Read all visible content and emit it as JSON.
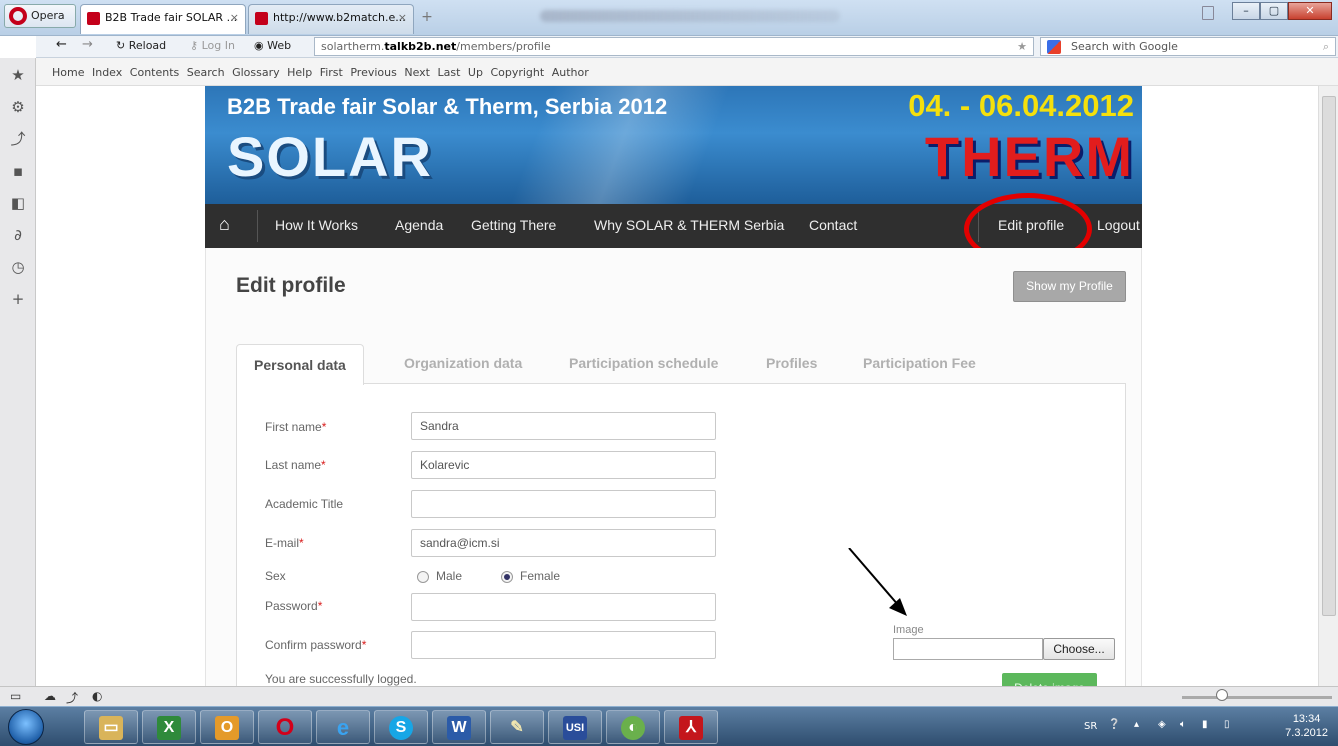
{
  "browser": {
    "opera_label": "Opera",
    "tabs": [
      {
        "title": "B2B Trade fair SOLAR ...",
        "close": "×"
      },
      {
        "title": "http://www.b2match.e...",
        "close": "×"
      }
    ],
    "new_tab": "+",
    "reload_label": "Reload",
    "login_label": "Log In",
    "web_label": "Web",
    "url_prefix": "solartherm.",
    "url_domain": "talkb2b.net",
    "url_path": "/members/profile",
    "search_placeholder": "Search with Google",
    "bookmarks": [
      "Home",
      "Index",
      "Contents",
      "Search",
      "Glossary",
      "Help",
      "First",
      "Previous",
      "Next",
      "Last",
      "Up",
      "Copyright",
      "Author"
    ]
  },
  "header": {
    "title": "B2B Trade fair Solar & Therm, Serbia 2012",
    "dates": "04. - 06.04.2012",
    "logo_left": "SOLAR",
    "logo_right": "THERM"
  },
  "nav": {
    "items": [
      "How It Works",
      "Agenda",
      "Getting There",
      "Why SOLAR & THERM Serbia",
      "Contact"
    ],
    "edit_profile": "Edit profile",
    "logout": "Logout"
  },
  "page": {
    "title": "Edit profile",
    "show_profile_btn": "Show my Profile",
    "tabs": [
      "Personal data",
      "Organization data",
      "Participation schedule",
      "Profiles",
      "Participation Fee"
    ]
  },
  "form": {
    "first_name_label": "First name",
    "first_name_value": "Sandra",
    "last_name_label": "Last name",
    "last_name_value": "Kolarevic",
    "academic_title_label": "Academic Title",
    "academic_title_value": "",
    "email_label": "E-mail",
    "email_value": "sandra@icm.si",
    "sex_label": "Sex",
    "sex_options": [
      "Male",
      "Female"
    ],
    "sex_selected": "Female",
    "password_label": "Password",
    "confirm_password_label": "Confirm password",
    "required_mark": "*",
    "status_message": "You are successfully logged.",
    "image_label": "Image",
    "choose_label": "Choose...",
    "delete_image_label": "Delete image"
  },
  "taskbar": {
    "lang": "SR",
    "time": "13:34",
    "date": "7.3.2012"
  },
  "colors": {
    "highlight_circle": "#e30000",
    "navbar_bg": "#2f2f2f",
    "date_yellow": "#f5e00c"
  }
}
